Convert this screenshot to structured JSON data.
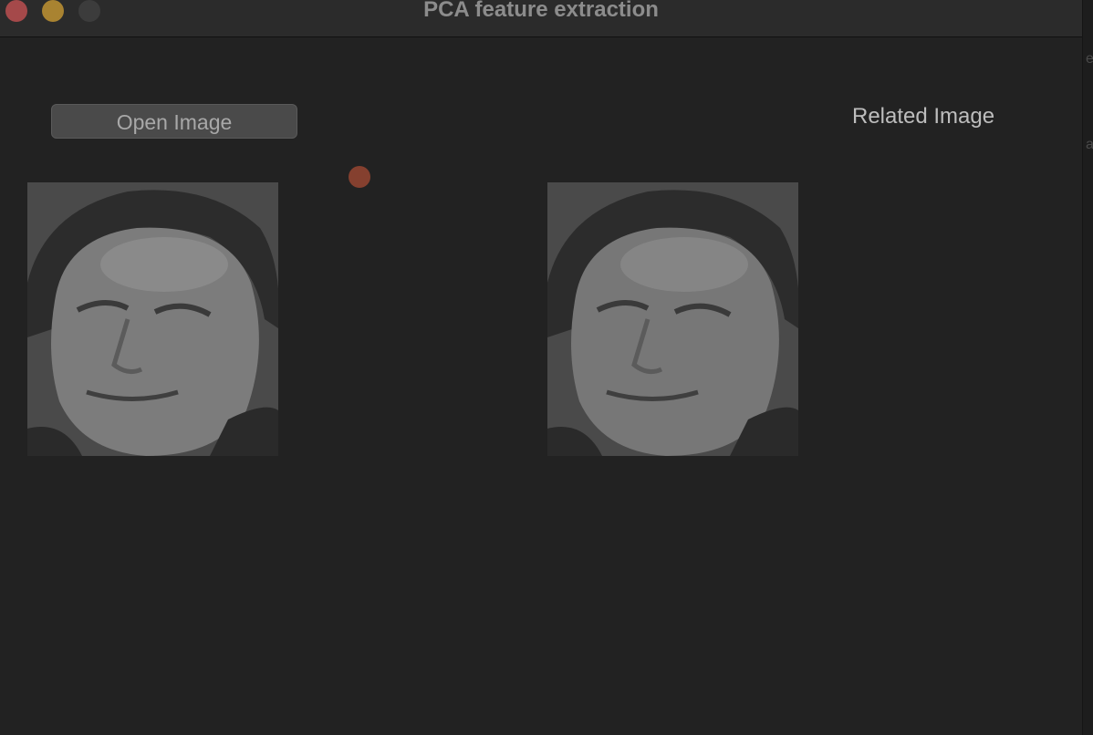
{
  "window": {
    "title": "PCA feature extraction",
    "traffic_lights": [
      "close",
      "minimize",
      "maximize"
    ],
    "colors": {
      "close": "#a5494a",
      "minimize": "#a98331",
      "maximize": "#3c3c3c",
      "background": "#222222"
    }
  },
  "toolbar": {
    "open_label": "Open Image"
  },
  "result": {
    "label": "Related Image"
  },
  "images": {
    "input_icon": "face-photo",
    "output_icon": "face-photo"
  },
  "edge": {
    "chars": [
      "e",
      "a"
    ]
  }
}
